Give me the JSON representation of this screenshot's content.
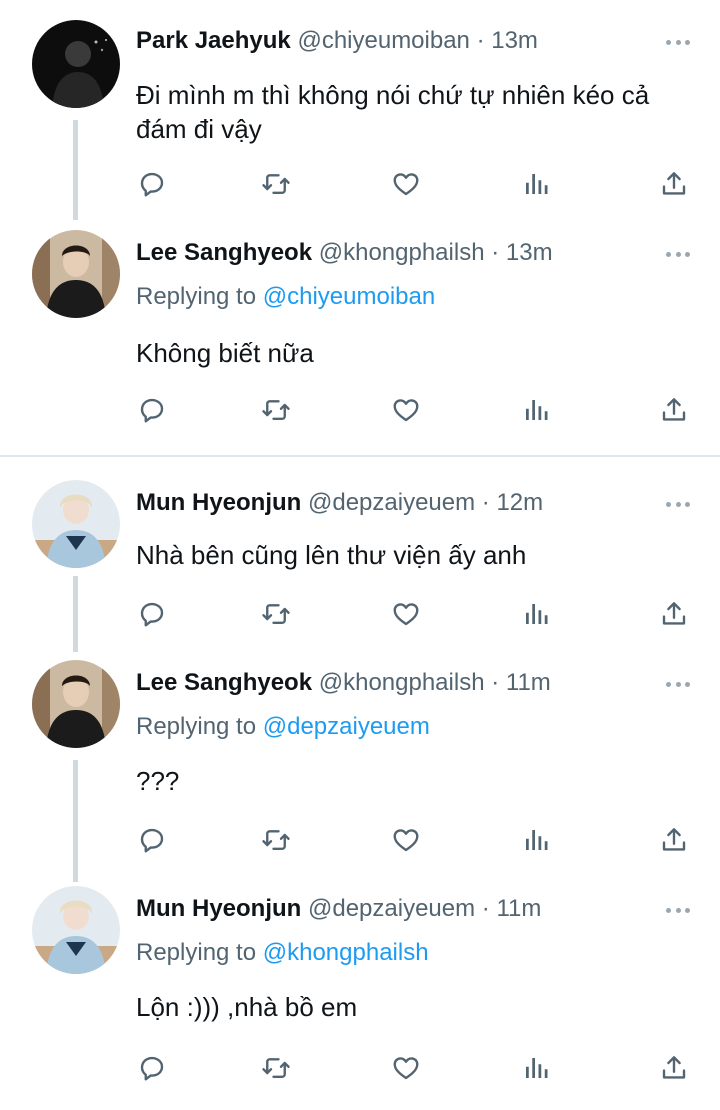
{
  "tweets": [
    {
      "name": "Park Jaehyuk",
      "meta": "@chiyeumoiban · 13m",
      "replying_label": "",
      "replying_handle": "",
      "text": "Đi mình m thì không nói chứ tự nhiên kéo cả đám đi vậy"
    },
    {
      "name": "Lee Sanghyeok",
      "meta": "@khongphailsh · 13m",
      "replying_label": "Replying to ",
      "replying_handle": "@chiyeumoiban",
      "text": "Không biết nữa"
    },
    {
      "name": "Mun Hyeonjun",
      "meta": "@depzaiyeuem · 12m",
      "replying_label": "",
      "replying_handle": "",
      "text": "Nhà bên cũng lên thư viện ấy anh"
    },
    {
      "name": "Lee Sanghyeok",
      "meta": "@khongphailsh · 11m",
      "replying_label": "Replying to ",
      "replying_handle": "@depzaiyeuem",
      "text": "???"
    },
    {
      "name": "Mun Hyeonjun",
      "meta": "@depzaiyeuem · 11m",
      "replying_label": "Replying to ",
      "replying_handle": "@khongphailsh",
      "text": "Lộn :))) ,nhà bồ em"
    }
  ],
  "icons": {
    "reply": "reply-icon",
    "retweet": "retweet-icon",
    "like": "like-icon",
    "analytics": "analytics-icon",
    "share": "share-icon",
    "more": "more-icon"
  },
  "colors": {
    "link": "#1d9bf0",
    "muted": "#536471",
    "thread_line": "#cfd9de"
  }
}
